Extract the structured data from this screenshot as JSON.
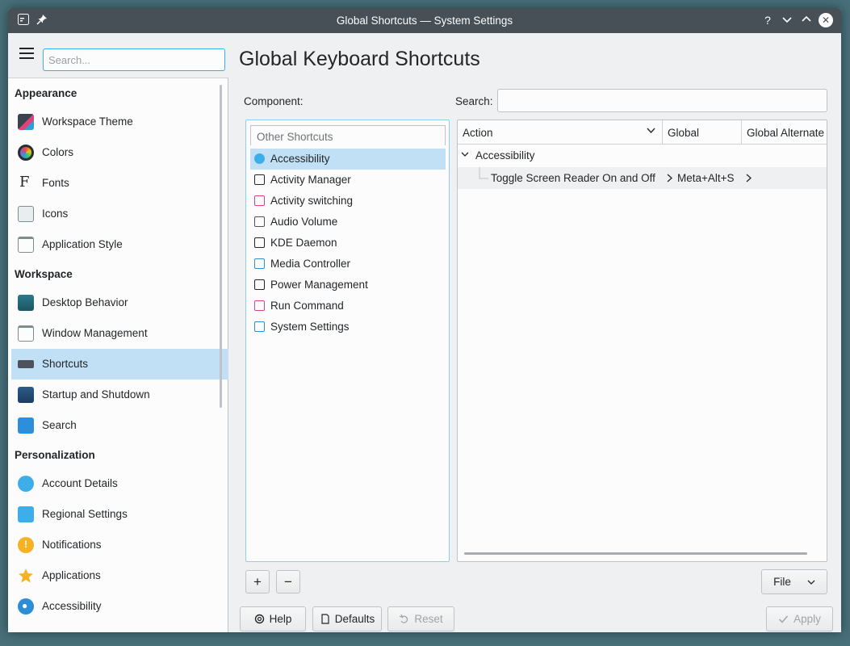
{
  "window": {
    "title": "Global Shortcuts — System Settings"
  },
  "sidebar": {
    "search_placeholder": "Search...",
    "categories": [
      {
        "label": "Appearance",
        "items": [
          {
            "label": "Workspace Theme",
            "icon": "workspace-theme-icon"
          },
          {
            "label": "Colors",
            "icon": "colors-icon"
          },
          {
            "label": "Fonts",
            "icon": "fonts-icon"
          },
          {
            "label": "Icons",
            "icon": "icons-icon"
          },
          {
            "label": "Application Style",
            "icon": "application-style-icon"
          }
        ]
      },
      {
        "label": "Workspace",
        "items": [
          {
            "label": "Desktop Behavior",
            "icon": "desktop-behavior-icon"
          },
          {
            "label": "Window Management",
            "icon": "window-management-icon"
          },
          {
            "label": "Shortcuts",
            "icon": "keyboard-icon",
            "selected": true
          },
          {
            "label": "Startup and Shutdown",
            "icon": "startup-icon"
          },
          {
            "label": "Search",
            "icon": "search-icon"
          }
        ]
      },
      {
        "label": "Personalization",
        "items": [
          {
            "label": "Account Details",
            "icon": "account-icon"
          },
          {
            "label": "Regional Settings",
            "icon": "regional-icon"
          },
          {
            "label": "Notifications",
            "icon": "notifications-icon"
          },
          {
            "label": "Applications",
            "icon": "star-icon"
          },
          {
            "label": "Accessibility",
            "icon": "accessibility-icon"
          }
        ]
      }
    ]
  },
  "main": {
    "title": "Global Keyboard Shortcuts",
    "component_label": "Component:",
    "search_label": "Search:",
    "search_value": "",
    "components_header": "Other Shortcuts",
    "components": [
      {
        "label": "Accessibility",
        "selected": true
      },
      {
        "label": "Activity Manager"
      },
      {
        "label": "Activity switching"
      },
      {
        "label": "Audio Volume"
      },
      {
        "label": "KDE Daemon"
      },
      {
        "label": "Media Controller"
      },
      {
        "label": "Power Management"
      },
      {
        "label": "Run Command"
      },
      {
        "label": "System Settings"
      }
    ],
    "table": {
      "columns": [
        "Action",
        "Global",
        "Global Alternate"
      ],
      "group": "Accessibility",
      "rows": [
        {
          "action": "Toggle Screen Reader On and Off",
          "global": "Meta+Alt+S"
        }
      ]
    },
    "buttons": {
      "add": "+",
      "remove": "−",
      "file": "File",
      "help": "Help",
      "defaults": "Defaults",
      "reset": "Reset",
      "apply": "Apply"
    }
  },
  "colors": {
    "accent": "#3daee9",
    "selection": "#c2e0f5",
    "titlebar": "#475057"
  }
}
